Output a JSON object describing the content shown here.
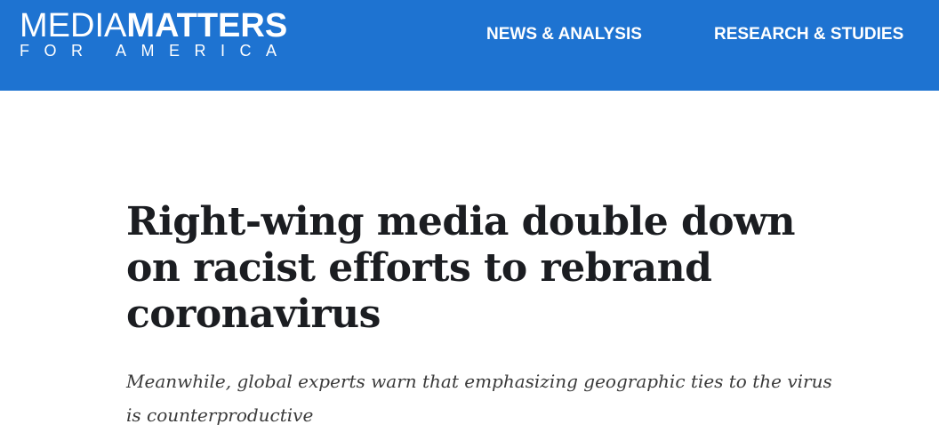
{
  "header": {
    "bg_color": "#1e73d1",
    "logo": {
      "word1": "MEDIA",
      "word2": "MATTERS",
      "tagline": "FOR AMERICA"
    },
    "nav": [
      {
        "label": "NEWS & ANALYSIS"
      },
      {
        "label": "RESEARCH & STUDIES"
      }
    ]
  },
  "article": {
    "title": "Right-wing media double down on racist efforts to rebrand coronavirus",
    "subtitle": "Meanwhile, global experts warn that emphasizing geographic ties to the virus is counterproductive"
  }
}
